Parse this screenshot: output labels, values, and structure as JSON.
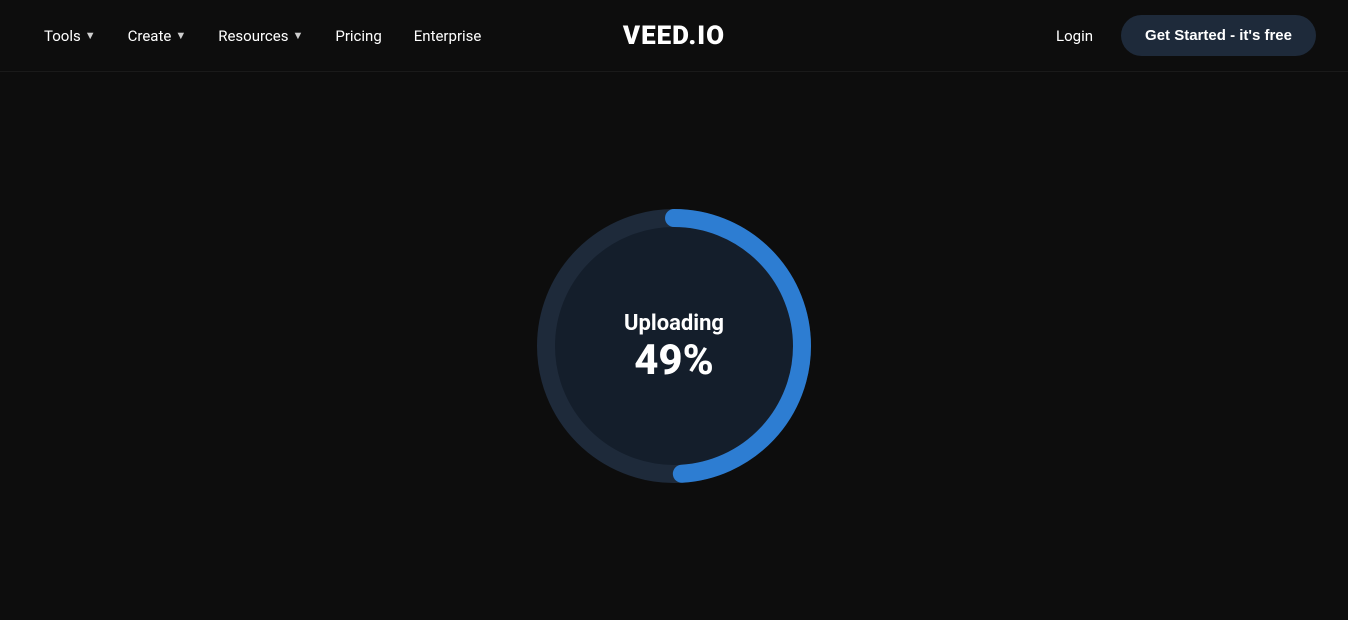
{
  "navbar": {
    "logo": "VEED.IO",
    "nav_items": [
      {
        "label": "Tools",
        "has_dropdown": true
      },
      {
        "label": "Create",
        "has_dropdown": true
      },
      {
        "label": "Resources",
        "has_dropdown": true
      },
      {
        "label": "Pricing",
        "has_dropdown": false
      },
      {
        "label": "Enterprise",
        "has_dropdown": false
      }
    ],
    "login_label": "Login",
    "get_started_label": "Get Started - it's free"
  },
  "upload": {
    "status_label": "Uploading",
    "percent_label": "49%",
    "percent_value": 49,
    "circumference": 804.25,
    "colors": {
      "track": "#1e2a3a",
      "progress": "#2d7dd2",
      "inner_bg": "#141e2b"
    }
  }
}
